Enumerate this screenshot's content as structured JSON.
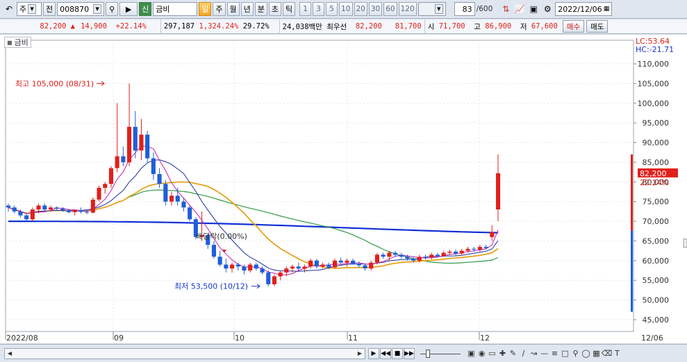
{
  "toolbar": {
    "market": "주",
    "prev_label": "전",
    "code": "008870",
    "sound_icon": "speaker-icon",
    "badge_label": "신",
    "name": "금비",
    "periods": [
      "일",
      "주",
      "월",
      "년",
      "분",
      "초",
      "틱"
    ],
    "active_period": "일",
    "intervals": [
      "1",
      "3",
      "5",
      "10",
      "20",
      "30",
      "60",
      "120"
    ],
    "count": "83",
    "count_total": "/600",
    "date": "2022/12/06"
  },
  "infobar": {
    "price": "82,200",
    "change": "14,900",
    "change_rate": "+22.14%",
    "volume": "297,187",
    "volume_rate": "1,324.24%",
    "turnover": "29.72%",
    "trade_amount": "24,038백만",
    "best_label": "최우선",
    "ask": "82,200",
    "bid": "81,700",
    "open_label": "시",
    "open": "71,700",
    "high_label": "고",
    "high": "86,900",
    "low_label": "저",
    "low": "67,600",
    "buy_label": "매수",
    "sell_label": "매도"
  },
  "legend": {
    "name": "금비"
  },
  "chart_data": {
    "type": "candlestick",
    "annotations": {
      "high": "최고 105,000 (08/31)",
      "low": "최저 53,500 (10/12)",
      "dividend": "배당락(0.00%)",
      "lc": "LC:53.64",
      "hc": "HC:-21.71",
      "last_price": "82,200",
      "last_rate": "22.14%"
    },
    "x_labels": [
      "2022/08",
      "09",
      "10",
      "11",
      "12",
      "12/06"
    ],
    "y_ticks": [
      "110,000",
      "105,000",
      "100,000",
      "95,000",
      "90,000",
      "85,000",
      "80,000",
      "75,000",
      "70,000",
      "65,000",
      "60,000",
      "55,000",
      "50,000",
      "45,000"
    ],
    "ylim": [
      42000,
      116000
    ],
    "candles": [
      [
        74000,
        74500,
        72500,
        73500
      ],
      [
        73500,
        74000,
        72000,
        72500
      ],
      [
        72500,
        73000,
        71000,
        71500
      ],
      [
        71500,
        72000,
        70000,
        70500
      ],
      [
        70500,
        73500,
        70000,
        73000
      ],
      [
        73000,
        74500,
        72000,
        74000
      ],
      [
        74000,
        74500,
        72500,
        73000
      ],
      [
        73000,
        74000,
        72500,
        73500
      ],
      [
        73500,
        73800,
        72800,
        73200
      ],
      [
        73200,
        73600,
        72400,
        72800
      ],
      [
        72800,
        73200,
        72000,
        72300
      ],
      [
        72300,
        73000,
        71500,
        72800
      ],
      [
        72800,
        73500,
        72000,
        72400
      ],
      [
        72400,
        73000,
        71800,
        72200
      ],
      [
        72200,
        76000,
        72000,
        75500
      ],
      [
        75500,
        79000,
        75000,
        78500
      ],
      [
        78500,
        80000,
        77000,
        79500
      ],
      [
        79500,
        84000,
        78500,
        83500
      ],
      [
        83500,
        100000,
        82500,
        86500
      ],
      [
        86500,
        89000,
        84000,
        85000
      ],
      [
        85000,
        105000,
        84000,
        94000
      ],
      [
        94000,
        98000,
        86000,
        88000
      ],
      [
        88000,
        96000,
        85500,
        92000
      ],
      [
        92000,
        93000,
        85000,
        86000
      ],
      [
        86000,
        87500,
        80500,
        82000
      ],
      [
        82000,
        83500,
        78500,
        79500
      ],
      [
        79500,
        80500,
        74000,
        75000
      ],
      [
        75000,
        77500,
        74000,
        76500
      ],
      [
        76500,
        78500,
        74000,
        75000
      ],
      [
        75000,
        76000,
        72500,
        73500
      ],
      [
        73500,
        74000,
        70000,
        70500
      ],
      [
        70500,
        71000,
        65500,
        66000
      ],
      [
        66000,
        72500,
        65000,
        66500
      ],
      [
        66500,
        67000,
        63000,
        64000
      ],
      [
        64000,
        65000,
        60500,
        61000
      ],
      [
        61000,
        62500,
        58500,
        59000
      ],
      [
        59000,
        60500,
        57000,
        58000
      ],
      [
        58000,
        59500,
        57000,
        59000
      ],
      [
        59000,
        59500,
        57500,
        58500
      ],
      [
        58500,
        59000,
        56500,
        57500
      ],
      [
        57500,
        59500,
        57000,
        59000
      ],
      [
        59000,
        59500,
        57500,
        58000
      ],
      [
        58000,
        58500,
        56500,
        57000
      ],
      [
        57000,
        57500,
        53500,
        54000
      ],
      [
        54000,
        56500,
        53500,
        56000
      ],
      [
        56000,
        57500,
        55000,
        57000
      ],
      [
        57000,
        58500,
        56000,
        58000
      ],
      [
        58000,
        59000,
        57000,
        58500
      ],
      [
        58500,
        59500,
        57500,
        58000
      ],
      [
        58000,
        59000,
        57000,
        58500
      ],
      [
        58500,
        60500,
        58000,
        60000
      ],
      [
        60000,
        60500,
        58000,
        58500
      ],
      [
        58500,
        59500,
        58000,
        59000
      ],
      [
        59000,
        59500,
        57800,
        58300
      ],
      [
        58300,
        60500,
        58000,
        60000
      ],
      [
        60000,
        60800,
        59000,
        59500
      ],
      [
        59500,
        60500,
        58500,
        60000
      ],
      [
        60000,
        60500,
        59000,
        59200
      ],
      [
        59200,
        59800,
        58300,
        58800
      ],
      [
        58800,
        59300,
        57500,
        58000
      ],
      [
        58000,
        60000,
        57500,
        59500
      ],
      [
        59500,
        62000,
        59000,
        61500
      ],
      [
        61500,
        62000,
        60500,
        61000
      ],
      [
        61000,
        62500,
        60000,
        62000
      ],
      [
        62000,
        62500,
        61000,
        61500
      ],
      [
        61500,
        62000,
        60500,
        61000
      ],
      [
        61000,
        61500,
        60000,
        60500
      ],
      [
        60500,
        61000,
        59500,
        60000
      ],
      [
        60000,
        61500,
        59500,
        61000
      ],
      [
        61000,
        61500,
        60300,
        60800
      ],
      [
        60800,
        62000,
        60300,
        61500
      ],
      [
        61500,
        62000,
        61000,
        61200
      ],
      [
        61200,
        62500,
        61000,
        62000
      ],
      [
        62000,
        62800,
        61500,
        62300
      ],
      [
        62300,
        62800,
        61300,
        61800
      ],
      [
        61800,
        63000,
        61300,
        62500
      ],
      [
        62500,
        63500,
        62000,
        63000
      ],
      [
        63000,
        63500,
        62300,
        62800
      ],
      [
        62800,
        64000,
        62300,
        63500
      ],
      [
        63500,
        64000,
        62800,
        63200
      ],
      [
        66000,
        69000,
        65000,
        67300
      ],
      [
        73000,
        87000,
        70000,
        82200
      ]
    ],
    "ma_long_label": "",
    "colors": {
      "up": "#e0201b",
      "down": "#1e5fd8",
      "ma5": "#c01fb0",
      "ma10": "#1a2f9c",
      "ma20": "#e5a21a",
      "ma60": "#2e9a48",
      "ma120": "#1230d6"
    }
  }
}
